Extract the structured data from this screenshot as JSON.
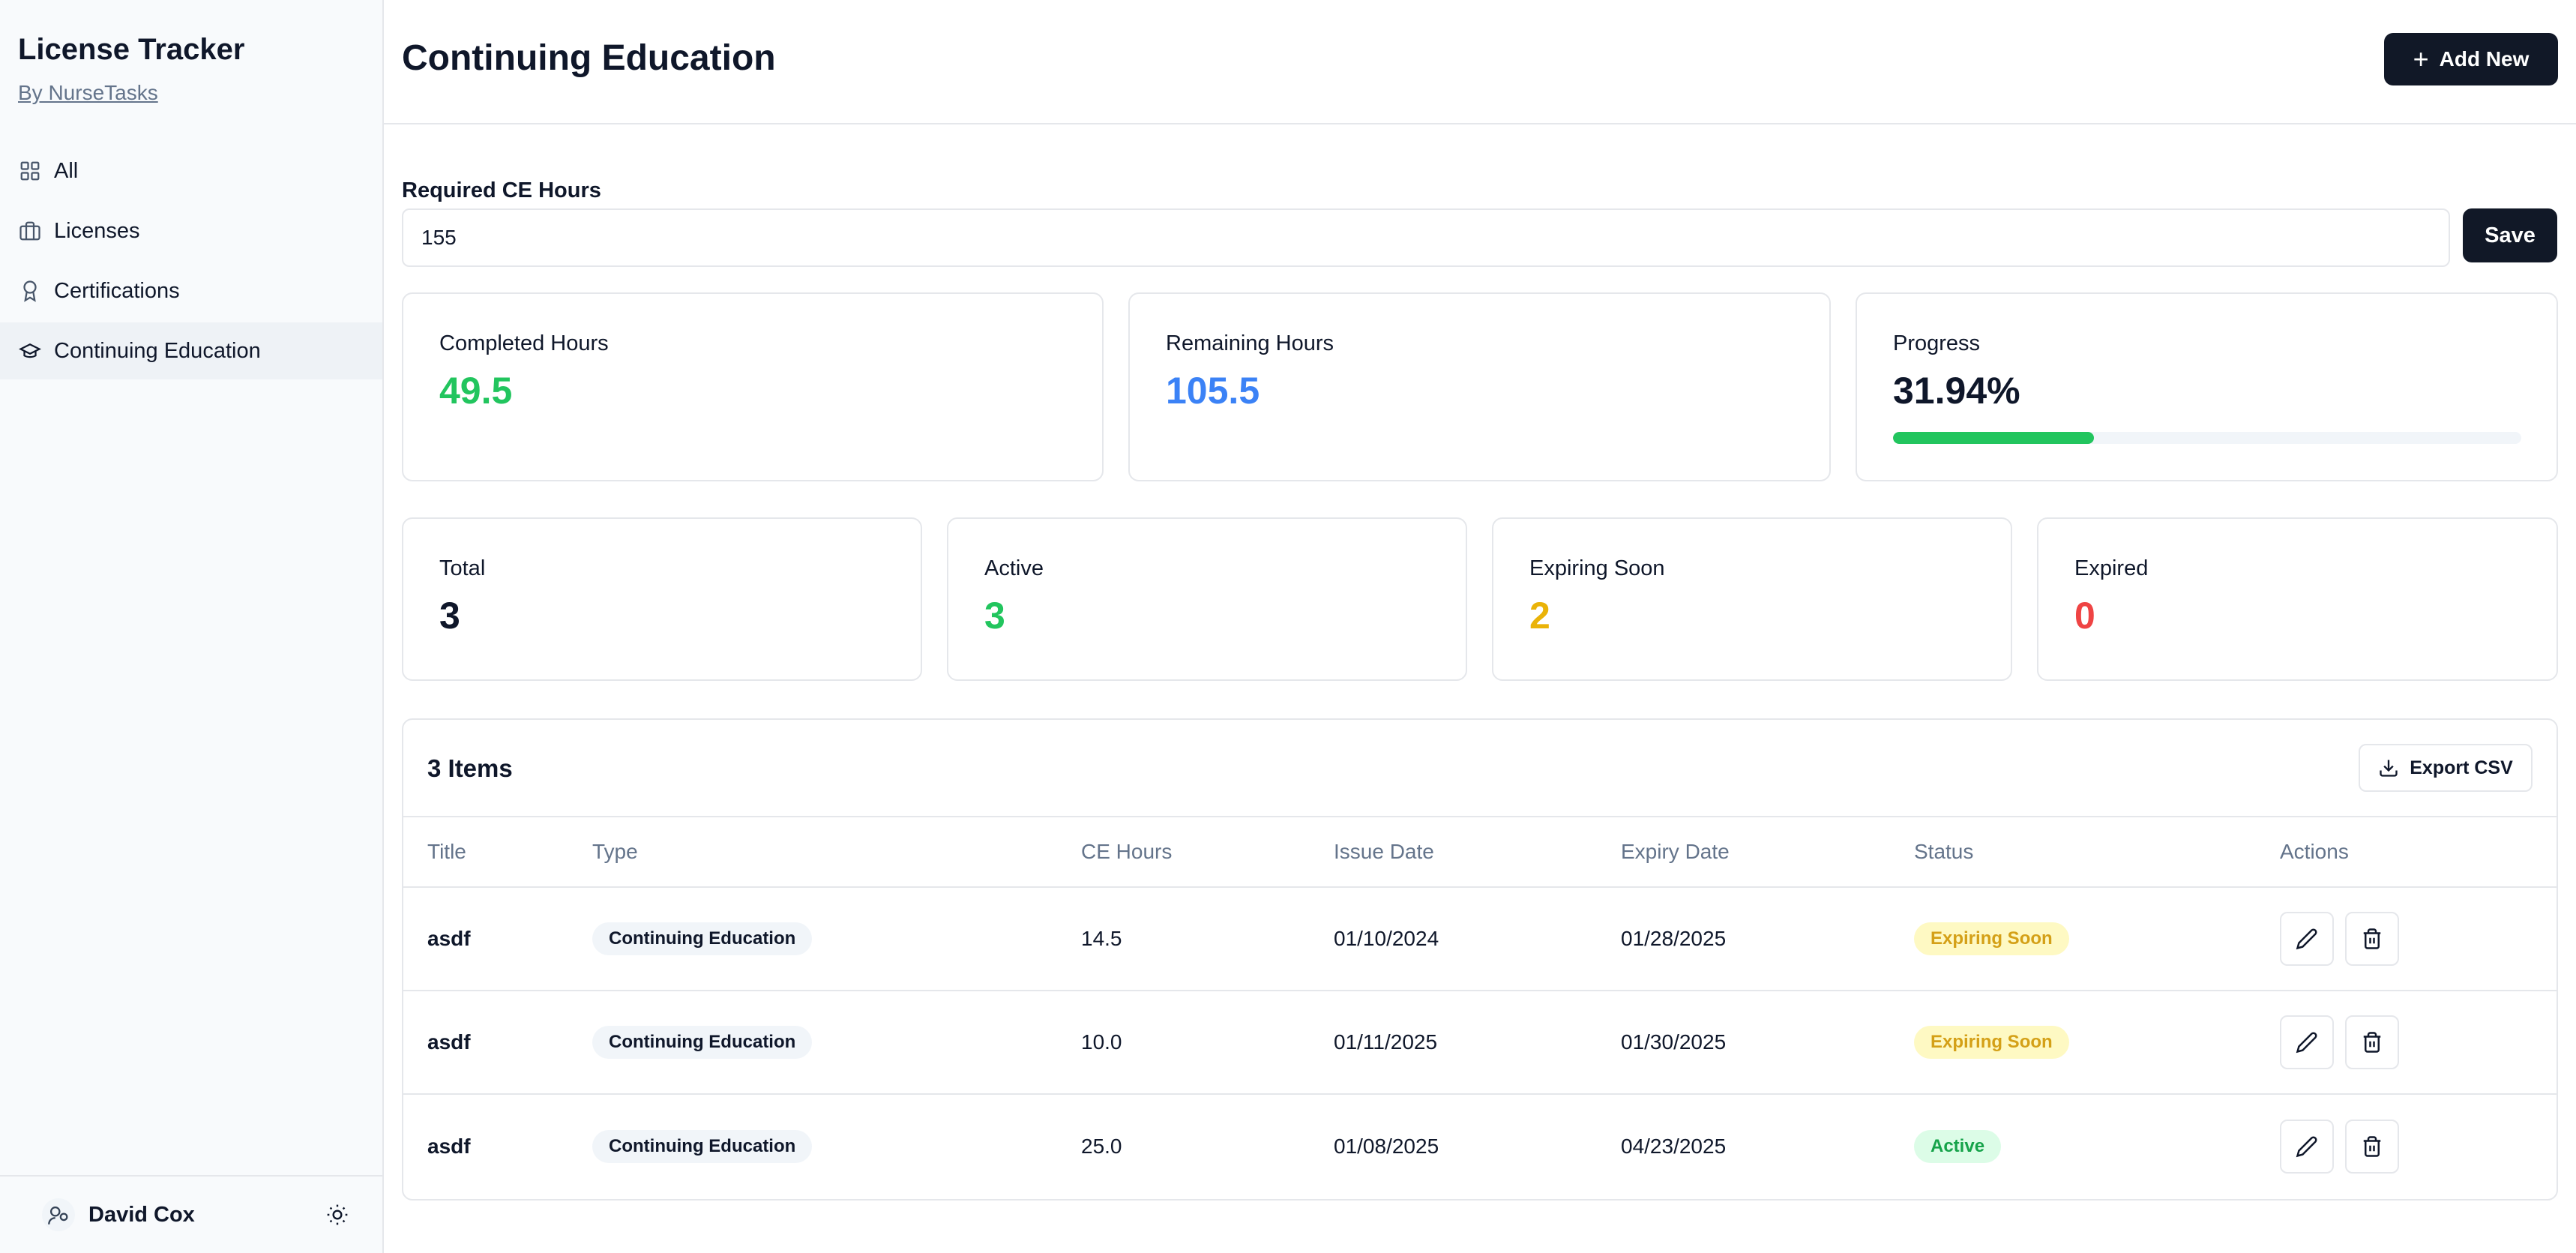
{
  "app": {
    "title": "License Tracker",
    "subtitle": "By NurseTasks"
  },
  "sidebar": {
    "items": [
      {
        "label": "All",
        "icon": "grid-icon"
      },
      {
        "label": "Licenses",
        "icon": "briefcase-icon"
      },
      {
        "label": "Certifications",
        "icon": "award-icon"
      },
      {
        "label": "Continuing Education",
        "icon": "graduation-cap-icon",
        "active": true
      }
    ],
    "user": {
      "name": "David Cox"
    }
  },
  "header": {
    "title": "Continuing Education",
    "add_label": "Add New"
  },
  "ce_form": {
    "label": "Required CE Hours",
    "value": "155",
    "save_label": "Save"
  },
  "hours": {
    "completed_label": "Completed Hours",
    "completed_value": "49.5",
    "remaining_label": "Remaining Hours",
    "remaining_value": "105.5",
    "progress_label": "Progress",
    "progress_value": "31.94%",
    "progress_fraction": 0.3194
  },
  "stats": {
    "total_label": "Total",
    "total_value": "3",
    "active_label": "Active",
    "active_value": "3",
    "expiring_label": "Expiring Soon",
    "expiring_value": "2",
    "expired_label": "Expired",
    "expired_value": "0"
  },
  "colors": {
    "green": "#22c55e",
    "blue": "#3b82f6",
    "amber": "#eab308",
    "red": "#ef4444",
    "dark_button": "#111827"
  },
  "table": {
    "title": "3 Items",
    "export_label": "Export CSV",
    "columns": [
      "Title",
      "Type",
      "CE Hours",
      "Issue Date",
      "Expiry Date",
      "Status",
      "Actions"
    ],
    "rows": [
      {
        "title": "asdf",
        "type": "Continuing Education",
        "hours": "14.5",
        "issue": "01/10/2024",
        "expiry": "01/28/2025",
        "status": "Expiring Soon"
      },
      {
        "title": "asdf",
        "type": "Continuing Education",
        "hours": "10.0",
        "issue": "01/11/2025",
        "expiry": "01/30/2025",
        "status": "Expiring Soon"
      },
      {
        "title": "asdf",
        "type": "Continuing Education",
        "hours": "25.0",
        "issue": "01/08/2025",
        "expiry": "04/23/2025",
        "status": "Active"
      }
    ]
  }
}
